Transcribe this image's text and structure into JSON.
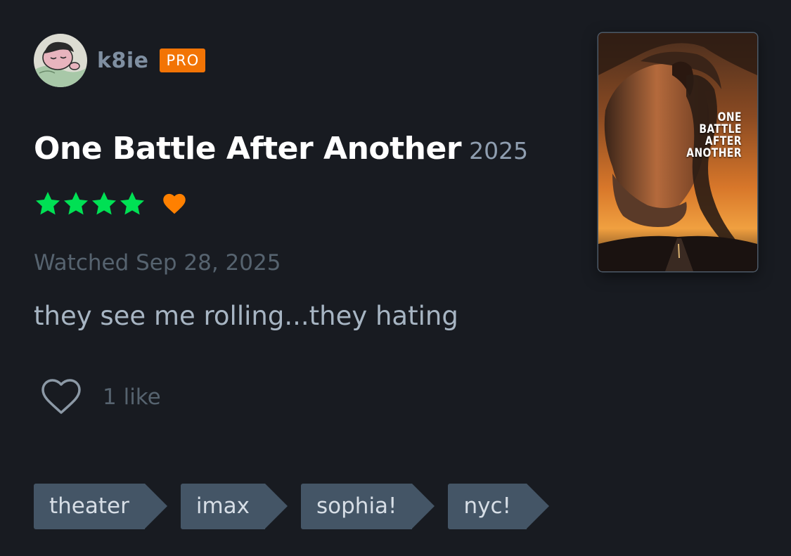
{
  "user": {
    "avatar_icon": "cartoon-avatar",
    "name": "k8ie",
    "badge": "PRO",
    "badge_color": "#f27405"
  },
  "film": {
    "title": "One Battle After Another",
    "year": "2025",
    "poster_title_lines": [
      "ONE",
      "BATTLE",
      "AFTER",
      "ANOTHER"
    ]
  },
  "rating": {
    "stars": 4,
    "max_stars": 5,
    "star_color": "#00e054",
    "liked": true,
    "liked_color": "#ff8000"
  },
  "watched": "Watched Sep 28, 2025",
  "review": "they see me rolling...they hating",
  "likes": {
    "icon": "heart-outline-icon",
    "count_label": "1 like"
  },
  "tags": [
    "theater",
    "imax",
    "sophia!",
    "nyc!"
  ],
  "colors": {
    "background": "#181b21",
    "tag_background": "#445566"
  }
}
